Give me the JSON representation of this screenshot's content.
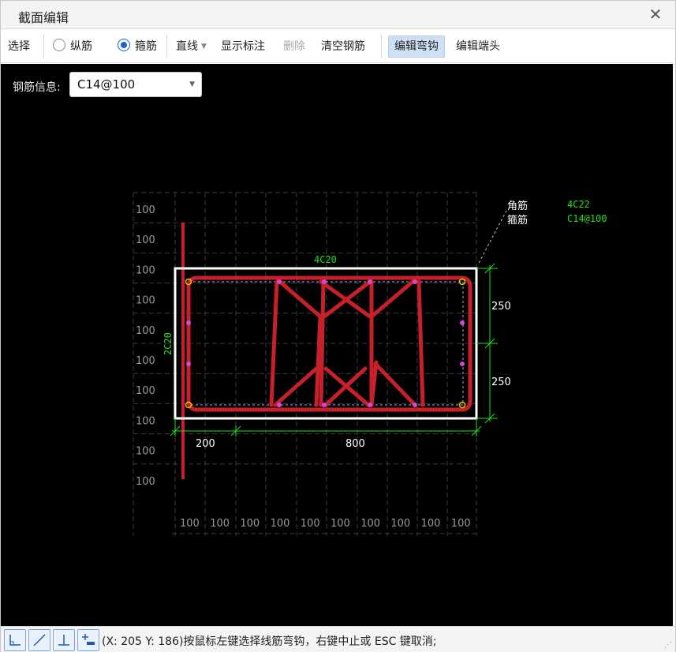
{
  "window": {
    "title": "截面编辑"
  },
  "toolbar": {
    "select_label": "选择",
    "longitudinal_label": "纵筋",
    "stirrup_label": "箍筋",
    "line_mode_label": "直线",
    "show_annotation_label": "显示标注",
    "delete_label": "删除",
    "clear_rebar_label": "清空钢筋",
    "edit_hook_label": "编辑弯钩",
    "edit_end_label": "编辑端头",
    "selected_type": "箍筋"
  },
  "rebar_info": {
    "label": "钢筋信息:",
    "value": "C14@100"
  },
  "drawing": {
    "grid_label": "100",
    "top_rebar": "4C20",
    "side_rebar": "2C20",
    "dim_left": "200",
    "dim_width": "800",
    "dim_h1": "250",
    "dim_h2": "250",
    "legend": [
      {
        "name": "角筋",
        "value": "4C22"
      },
      {
        "name": "箍筋",
        "value": "C14@100"
      }
    ],
    "colors": {
      "stirrup": "#c8202a",
      "grid": "#3a3a48",
      "dimension": "#1fe01f",
      "outline": "#ffffff"
    }
  },
  "statusbar": {
    "tools": [
      "orthogonal-icon",
      "diagonal-icon",
      "perpendicular-icon",
      "add-point-icon"
    ],
    "message": "(X: 205 Y: 186)按鼠标左键选择线筋弯钩，右键中止或 ESC 键取消;"
  }
}
